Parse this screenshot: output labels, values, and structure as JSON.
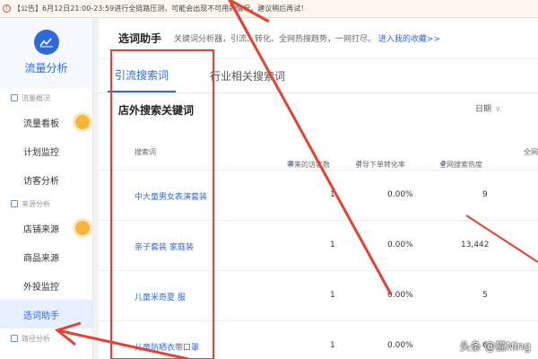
{
  "notice": {
    "text": "【公告】6月12日21:00-23:59进行全链路压测，可能会出现不可用的情况，建议稍后再试！"
  },
  "sidebar": {
    "title": "流量分析",
    "sections": [
      {
        "label": "流量概况",
        "items": [
          {
            "label": "流量看板",
            "badge": true
          },
          {
            "label": "计划监控",
            "badge": false
          },
          {
            "label": "访客分析",
            "badge": false
          }
        ]
      },
      {
        "label": "来源分析",
        "items": [
          {
            "label": "店铺来源",
            "badge": true
          },
          {
            "label": "商品来源",
            "badge": false
          },
          {
            "label": "外投监控",
            "badge": false
          },
          {
            "label": "选词助手",
            "badge": false,
            "active": true
          }
        ]
      },
      {
        "label": "路径分析",
        "items": []
      }
    ]
  },
  "header": {
    "title": "选词助手",
    "desc": "关键词分析器，引流、转化、全网热搜趋势，一网打尽。",
    "link": "进入我的收藏>>"
  },
  "tabs": [
    {
      "label": "引流搜索词",
      "active": true
    },
    {
      "label": "行业相关搜索词",
      "active": false
    }
  ],
  "section": {
    "title": "店外搜索关键词",
    "date_label": "日期",
    "date_chevron": "∨"
  },
  "table": {
    "columns": [
      "搜索词",
      "带来的访客数",
      "引导下单转化率",
      "全网搜索热度",
      "全网"
    ],
    "rows": [
      {
        "keyword": "中大童男女表演套装",
        "visitors": "1",
        "rate": "0.00%",
        "heat": "9"
      },
      {
        "keyword": "亲子套装 家庭装",
        "visitors": "1",
        "rate": "0.00%",
        "heat": "13,442"
      },
      {
        "keyword": "儿童米奇夏 服",
        "visitors": "1",
        "rate": "0.00%",
        "heat": "5"
      },
      {
        "keyword": "儿童防晒衣带口罩",
        "visitors": "1",
        "rate": "0.00%",
        "heat": "6"
      }
    ]
  },
  "watermark": "头条 @猫Ning",
  "colors": {
    "accent": "#2f6bd8",
    "annotation": "#e8412f",
    "badge": "#f7b53d"
  }
}
